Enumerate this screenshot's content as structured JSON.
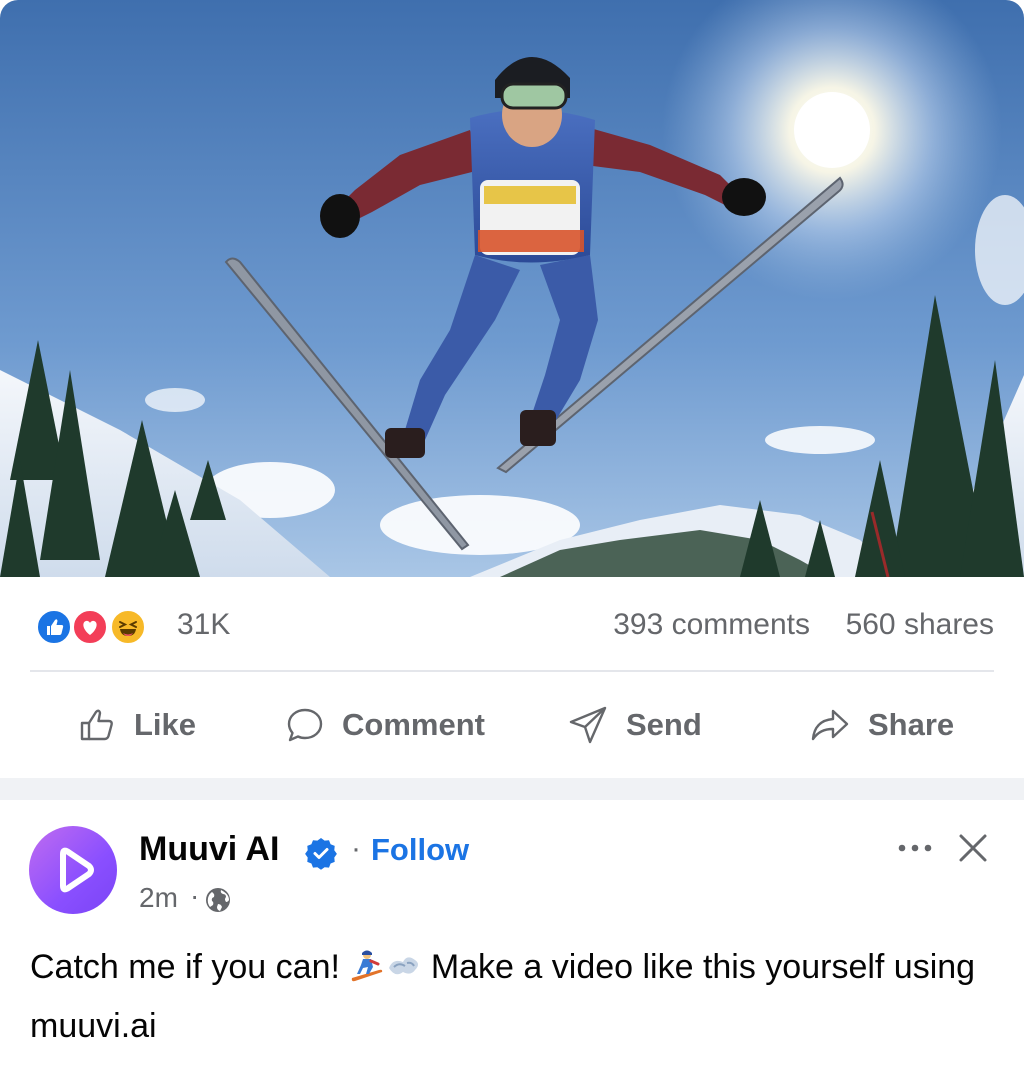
{
  "hero_image": {
    "description_icon": "ski-jumper-photo"
  },
  "reactions": {
    "icons": [
      "like-reaction-icon",
      "love-reaction-icon",
      "haha-reaction-icon"
    ],
    "count": "31K",
    "comments": "393 comments",
    "shares": "560 shares"
  },
  "actions": {
    "like": "Like",
    "comment": "Comment",
    "send": "Send",
    "share": "Share"
  },
  "post": {
    "author": "Muuvi AI",
    "follow": "Follow",
    "separator": "·",
    "time": "2m",
    "time_separator": "·",
    "text_before_emoji": "Catch me if you can! ",
    "text_after_emoji": " Make a video like this yourself using muuvi.ai"
  },
  "colors": {
    "accent": "#1b74e4",
    "muted_text": "#65676b",
    "like": "#1b74e4",
    "love": "#f33e58",
    "haha": "#f7b928",
    "avatar": "#8a4fff"
  }
}
